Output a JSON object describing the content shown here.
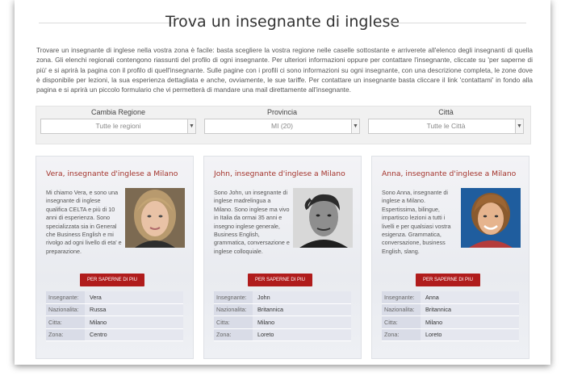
{
  "page": {
    "title": "Trova un insegnante di inglese",
    "intro": "Trovare un insegnante di inglese nella vostra zona è facile: basta scegliere la vostra regione nelle caselle sottostante e arriverete all'elenco degli insegnanti di quella zona. Gli elenchi regionali contengono riassunti del profilo di ogni insegnante. Per ulteriori informazioni oppure per contattare l'insegnante, cliccate su 'per saperne di più' e si aprirà la pagina con il profilo di quell'insegnante. Sulle pagine con i profili ci sono informazioni su ogni insegnante, con una descrizione completa, le zone dove è disponibile per lezioni, la sua esperienza dettagliata e anche, ovviamente, le sue tariffe. Per contattare un insegnante basta cliccare il link 'contattami' in fondo alla pagina e si aprirà un piccolo formulario che vi permetterà di mandare una mail direttamente all'insegnante."
  },
  "filters": {
    "region": {
      "label": "Cambia Regione",
      "value": "Tutte le regioni"
    },
    "province": {
      "label": "Provincia",
      "value": "MI  (20)"
    },
    "city": {
      "label": "Città",
      "value": "Tutte le Città"
    }
  },
  "table_labels": {
    "teacher": "Insegnante:",
    "nationality": "Nazionalita:",
    "city": "Citta:",
    "zone": "Zona:"
  },
  "teachers": [
    {
      "title": "Vera, insegnante d'inglese a Milano",
      "description": "Mi chiamo Vera, e sono una insegnante di inglese qualifica CELTA e più di 10 anni di esperienza. Sono specializzata sia in General che Business English e mi rivolgo ad ogni livello di eta' e preparazione.",
      "button": "PER SAPERNE DI PIU",
      "name": "Vera",
      "nationality": "Russa",
      "city": "Milano",
      "zone": "Centro"
    },
    {
      "title": "John, insegnante d'inglese a Milano",
      "description": "Sono John, un insegnante di inglese madrelingua a Milano. Sono inglese ma vivo in Italia da ormai 35 anni e insegno inglese generale, Business English, grammatica, conversazione e inglese colloquiale.",
      "button": "PER SAPERNE DI PIU",
      "name": "John",
      "nationality": "Britannica",
      "city": "Milano",
      "zone": "Loreto"
    },
    {
      "title": "Anna, insegnante d'inglese a Milano",
      "description": "Sono Anna, insegnante di inglese a Milano. Espertissima, bilingue, impartisco lezioni a tutti i livelli e per qualsiasi vostra esigenza. Grammatica, conversazione, business English, slang.",
      "button": "PER SAPERNE DI PIU",
      "name": "Anna",
      "nationality": "Britannica",
      "city": "Milano",
      "zone": "Loreto"
    }
  ]
}
